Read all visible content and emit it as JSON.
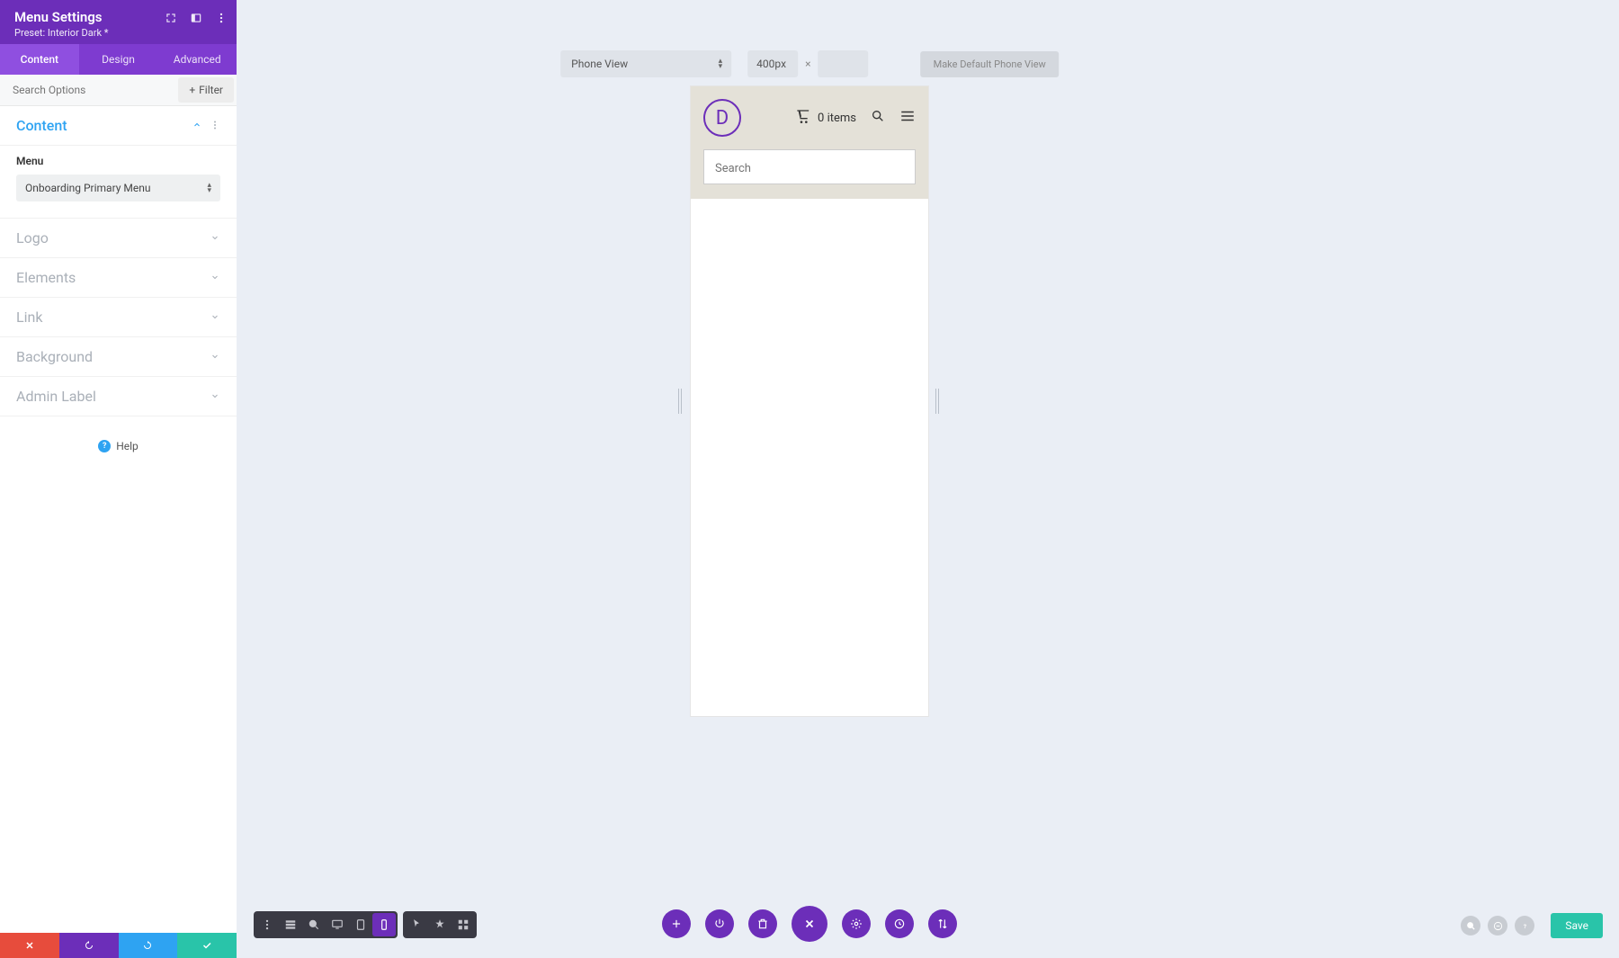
{
  "sidebar": {
    "title": "Menu Settings",
    "preset": "Preset: Interior Dark *",
    "tabs": [
      {
        "label": "Content",
        "active": true
      },
      {
        "label": "Design",
        "active": false
      },
      {
        "label": "Advanced",
        "active": false
      }
    ],
    "search_placeholder": "Search Options",
    "filter_label": "Filter",
    "sections": {
      "content": {
        "title": "Content",
        "open": true
      },
      "logo": {
        "title": "Logo"
      },
      "elements": {
        "title": "Elements"
      },
      "link": {
        "title": "Link"
      },
      "background": {
        "title": "Background"
      },
      "admin_label": {
        "title": "Admin Label"
      }
    },
    "menu_field": {
      "label": "Menu",
      "value": "Onboarding Primary Menu"
    },
    "help_label": "Help"
  },
  "viewport": {
    "view_mode": "Phone View",
    "width_value": "400px",
    "make_default_label": "Make Default Phone View"
  },
  "phone": {
    "logo_letter": "D",
    "cart_text": "0 items",
    "search_placeholder": "Search"
  },
  "bottom_right": {
    "save_label": "Save"
  }
}
